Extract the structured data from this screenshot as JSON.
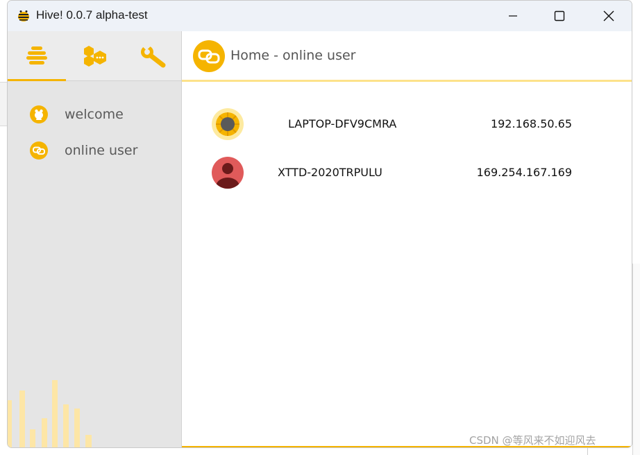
{
  "window": {
    "title": "Hive! 0.0.7 alpha-test",
    "accent": "#f5b400"
  },
  "sidebar": {
    "tabs": [
      {
        "icon": "hive-icon",
        "active": true
      },
      {
        "icon": "chat-bubbles-icon",
        "active": false
      },
      {
        "icon": "wrench-icon",
        "active": false
      }
    ],
    "items": [
      {
        "label": "welcome",
        "icon": "bee-icon"
      },
      {
        "label": "online user",
        "icon": "link-icon"
      }
    ]
  },
  "main": {
    "title": "Home - online user",
    "users": [
      {
        "name": "LAPTOP-DFV9CMRA",
        "ip": "192.168.50.65",
        "avatar": "sunflower-avatar"
      },
      {
        "name": "XTTD-2020TRPULU",
        "ip": "169.254.167.169",
        "avatar": "person-avatar"
      }
    ]
  },
  "watermark": "CSDN @等风来不如迎风去"
}
